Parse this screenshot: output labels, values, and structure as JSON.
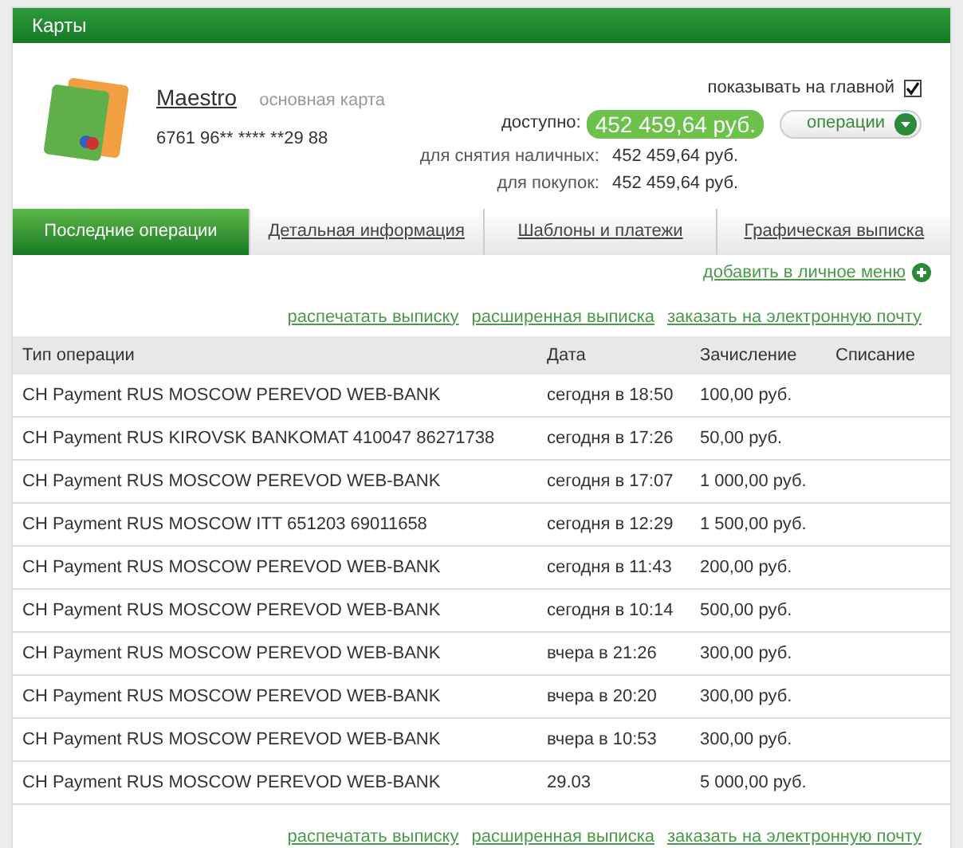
{
  "panel": {
    "title": "Карты"
  },
  "card": {
    "name": "Maestro",
    "note": "основная карта",
    "number": "6761 96** **** **29 88",
    "show_on_main": {
      "label": "показывать на главной",
      "checked": true
    },
    "available_label": "доступно:",
    "available": "452 459,64 руб.",
    "operations_button": "операции",
    "limits": [
      {
        "label": "для снятия наличных:",
        "value": "452 459,64 руб."
      },
      {
        "label": "для покупок:",
        "value": "452 459,64 руб."
      }
    ]
  },
  "tabs": [
    {
      "label": "Последние операции",
      "selected": true
    },
    {
      "label": "Детальная информация",
      "selected": false
    },
    {
      "label": "Шаблоны и платежи",
      "selected": false
    },
    {
      "label": "Графическая выписка",
      "selected": false
    }
  ],
  "add_link": "добавить в личное меню",
  "top_links": [
    "распечатать выписку",
    "расширенная выписка",
    "заказать на электронную почту"
  ],
  "table": {
    "columns": [
      "Тип операции",
      "Дата",
      "Зачисление",
      "Списание"
    ],
    "rows": [
      [
        "CH Payment RUS MOSCOW PEREVOD WEB-BANK",
        "сегодня в 18:50",
        "100,00 руб."
      ],
      [
        "CH Payment RUS KIROVSK BANKOMAT 410047 86271738",
        "сегодня в 17:26",
        "50,00 руб."
      ],
      [
        "CH Payment RUS MOSCOW PEREVOD WEB-BANK",
        "сегодня в 17:07",
        "1 000,00 руб."
      ],
      [
        "CH Payment RUS MOSCOW ITT 651203 69011658",
        "сегодня в 12:29",
        "1 500,00 руб."
      ],
      [
        "CH Payment RUS MOSCOW PEREVOD WEB-BANK",
        "сегодня в 11:43",
        "200,00 руб."
      ],
      [
        "CH Payment RUS MOSCOW PEREVOD WEB-BANK",
        "сегодня в 10:14",
        "500,00 руб."
      ],
      [
        "CH Payment RUS MOSCOW PEREVOD WEB-BANK",
        "вчера в 21:26",
        "300,00 руб."
      ],
      [
        "CH Payment RUS MOSCOW PEREVOD WEB-BANK",
        "вчера в 20:20",
        "300,00 руб."
      ],
      [
        "CH Payment RUS MOSCOW PEREVOD WEB-BANK",
        "вчера в 10:53",
        "300,00 руб."
      ],
      [
        "CH Payment RUS MOSCOW PEREVOD WEB-BANK",
        "29.03",
        "5 000,00 руб."
      ]
    ]
  },
  "bottom_links": [
    "распечатать выписку",
    "расширенная выписка",
    "заказать на электронную почту"
  ]
}
